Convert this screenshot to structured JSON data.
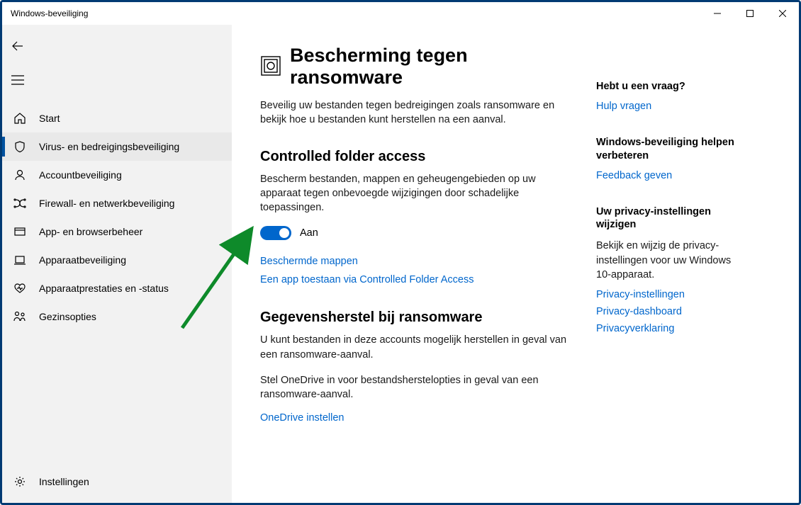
{
  "window": {
    "title": "Windows-beveiliging"
  },
  "sidebar": {
    "items": [
      {
        "label": "Start",
        "icon": "home"
      },
      {
        "label": "Virus- en bedreigingsbeveiliging",
        "icon": "shield",
        "selected": true
      },
      {
        "label": "Accountbeveiliging",
        "icon": "account"
      },
      {
        "label": "Firewall- en netwerkbeveiliging",
        "icon": "firewall"
      },
      {
        "label": "App- en browserbeheer",
        "icon": "appbrowser"
      },
      {
        "label": "Apparaatbeveiliging",
        "icon": "device"
      },
      {
        "label": "Apparaatprestaties en -status",
        "icon": "health"
      },
      {
        "label": "Gezinsopties",
        "icon": "family"
      }
    ],
    "settings_label": "Instellingen"
  },
  "main": {
    "title": "Bescherming tegen ransomware",
    "description": "Beveilig uw bestanden tegen bedreigingen zoals ransomware en bekijk hoe u bestanden kunt herstellen na een aanval.",
    "cfa": {
      "title": "Controlled folder access",
      "description": "Bescherm bestanden, mappen en geheugengebieden op uw apparaat tegen onbevoegde wijzigingen door schadelijke toepassingen.",
      "toggle_state": true,
      "toggle_label": "Aan",
      "link_protected": "Beschermde mappen",
      "link_allow": "Een app toestaan via Controlled Folder Access"
    },
    "recovery": {
      "title": "Gegevensherstel bij ransomware",
      "description": "U kunt bestanden in deze accounts mogelijk herstellen in geval van een ransomware-aanval.",
      "onedrive_desc": "Stel OneDrive in voor bestandsherstelopties in geval van een ransomware-aanval.",
      "link_onedrive": "OneDrive instellen"
    }
  },
  "right": {
    "help": {
      "title": "Hebt u een vraag?",
      "link": "Hulp vragen"
    },
    "feedback": {
      "title": "Windows-beveiliging helpen verbeteren",
      "link": "Feedback geven"
    },
    "privacy": {
      "title": "Uw privacy-instellingen wijzigen",
      "description": "Bekijk en wijzig de privacy-instellingen voor uw Windows 10-apparaat.",
      "link_settings": "Privacy-instellingen",
      "link_dashboard": "Privacy-dashboard",
      "link_statement": "Privacyverklaring"
    }
  }
}
